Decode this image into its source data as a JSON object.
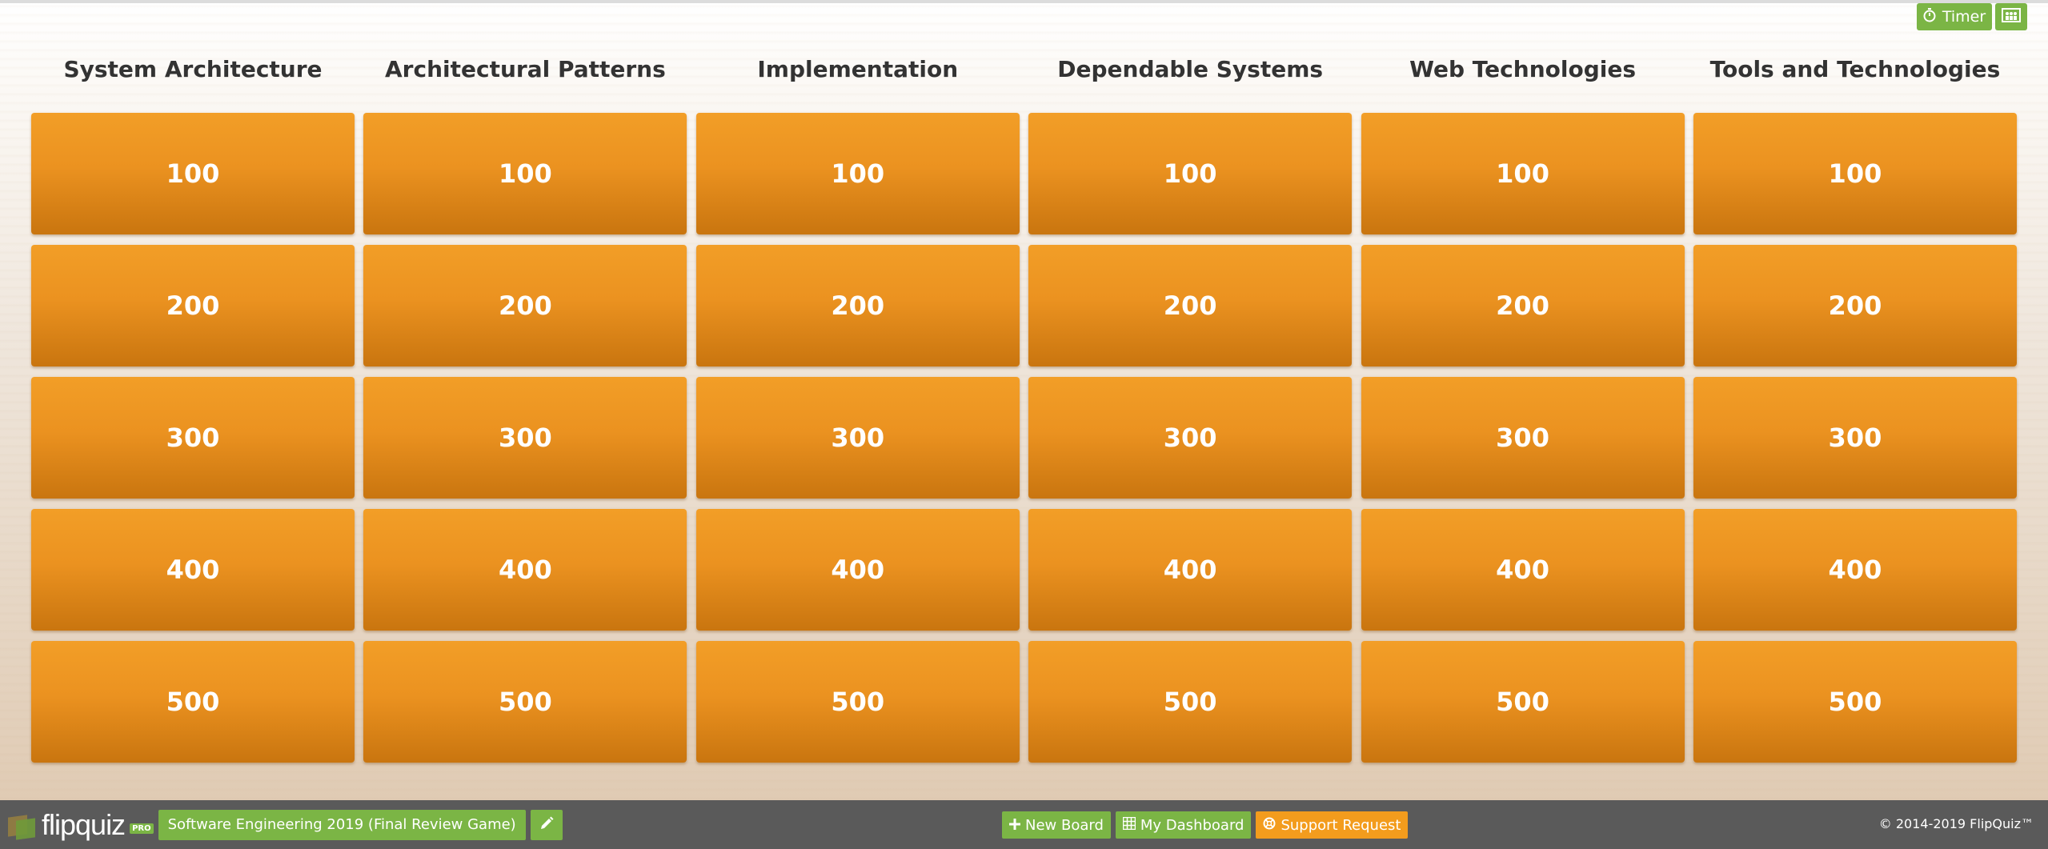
{
  "top_controls": {
    "timer_label": "Timer",
    "timer_icon": "stopwatch-icon",
    "teams_icon": "teams-icon"
  },
  "board": {
    "categories": [
      {
        "title": "System Architecture",
        "values": [
          "100",
          "200",
          "300",
          "400",
          "500"
        ]
      },
      {
        "title": "Architectural Patterns",
        "values": [
          "100",
          "200",
          "300",
          "400",
          "500"
        ]
      },
      {
        "title": "Implementation",
        "values": [
          "100",
          "200",
          "300",
          "400",
          "500"
        ]
      },
      {
        "title": "Dependable Systems",
        "values": [
          "100",
          "200",
          "300",
          "400",
          "500"
        ]
      },
      {
        "title": "Web Technologies",
        "values": [
          "100",
          "200",
          "300",
          "400",
          "500"
        ]
      },
      {
        "title": "Tools and Technologies",
        "values": [
          "100",
          "200",
          "300",
          "400",
          "500"
        ]
      }
    ]
  },
  "footer": {
    "logo_text": "flipquiz",
    "pro_badge": "PRO",
    "game_title": "Software Engineering 2019 (Final Review Game)",
    "edit_icon": "pencil-icon",
    "new_board_label": "New Board",
    "dashboard_label": "My Dashboard",
    "support_label": "Support Request",
    "copyright": "© 2014-2019 FlipQuiz™"
  },
  "colors": {
    "tile_orange": "#eb9220",
    "accent_green": "#7bb545",
    "footer_bg": "#5a5a5a",
    "support_orange": "#f39c1d"
  }
}
